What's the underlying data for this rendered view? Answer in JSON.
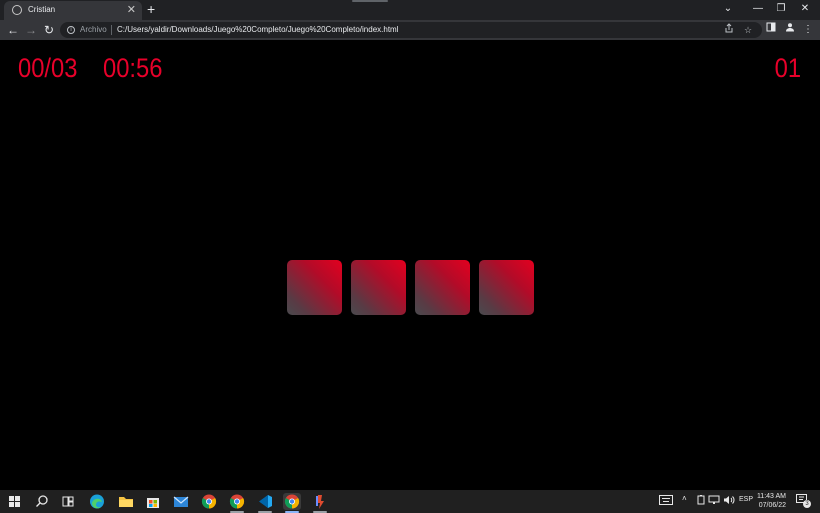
{
  "browser": {
    "tab": {
      "title": "Cristian",
      "close": "✕"
    },
    "new_tab": "+",
    "window_controls": {
      "list": "⌄",
      "minimize": "—",
      "restore": "❐",
      "close": "✕"
    },
    "nav": {
      "back": "←",
      "forward": "→",
      "reload": "↻"
    },
    "omnibox": {
      "info": "i",
      "chip": "Archivo",
      "url": "C:/Users/yaldir/Downloads/Juego%20Completo/Juego%20Completo/index.html",
      "share_icon": "share-icon",
      "bookmark_icon": "star-icon"
    },
    "toolbar_icons": [
      "side-panel-icon",
      "profile-icon",
      "kebab-menu-icon"
    ]
  },
  "game": {
    "score": "00/03",
    "timer": "00:56",
    "level": "01",
    "cards": [
      {
        "id": "card-1"
      },
      {
        "id": "card-2"
      },
      {
        "id": "card-3"
      },
      {
        "id": "card-4"
      }
    ],
    "accent": "#e8002a",
    "card_gradient": [
      "#e3001f",
      "#4a4a4e"
    ]
  },
  "taskbar": {
    "apps": [
      "start-icon",
      "search-icon",
      "task-view-icon",
      "edge-icon",
      "file-explorer-icon",
      "store-icon",
      "mail-icon",
      "chrome-icon",
      "chrome-icon",
      "vscode-icon",
      "chrome-icon",
      "app-icon"
    ],
    "tray": {
      "language": "ESP",
      "time": "11:43 AM",
      "date": "07/06/22",
      "notifications": "3"
    }
  }
}
